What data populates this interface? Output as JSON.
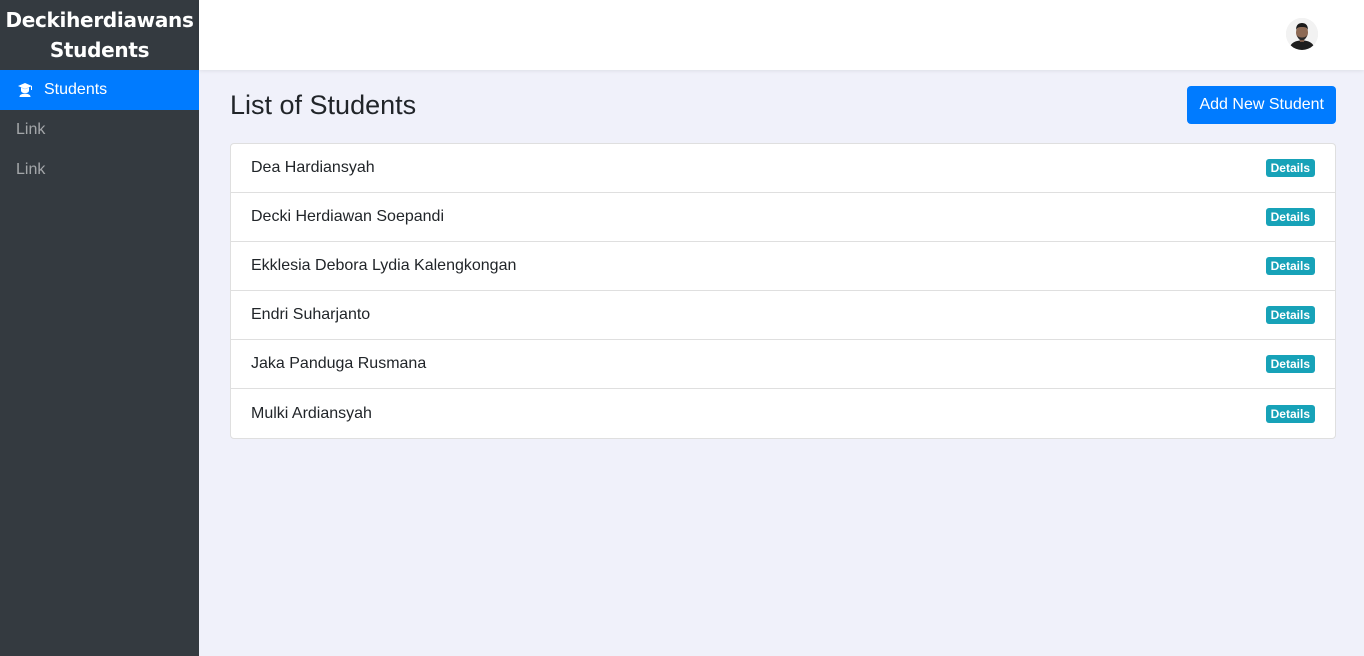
{
  "sidebar": {
    "brand_line1": "Deckiherdiawans",
    "brand_line2": "Students",
    "items": [
      {
        "label": "Students",
        "icon": "student-icon",
        "active": true
      },
      {
        "label": "Link"
      },
      {
        "label": "Link"
      }
    ]
  },
  "topbar": {
    "avatar": "user-avatar"
  },
  "main": {
    "title": "List of Students",
    "add_button": "Add New Student",
    "students": [
      {
        "name": "Dea Hardiansyah",
        "action": "Details"
      },
      {
        "name": "Decki Herdiawan Soepandi",
        "action": "Details"
      },
      {
        "name": "Ekklesia Debora Lydia Kalengkongan",
        "action": "Details"
      },
      {
        "name": "Endri Suharjanto",
        "action": "Details"
      },
      {
        "name": "Jaka Panduga Rusmana",
        "action": "Details"
      },
      {
        "name": "Mulki Ardiansyah",
        "action": "Details"
      }
    ]
  },
  "colors": {
    "sidebar_bg": "#343a40",
    "primary": "#007bff",
    "badge": "#17a2b8",
    "page_bg": "#f0f1fa"
  }
}
